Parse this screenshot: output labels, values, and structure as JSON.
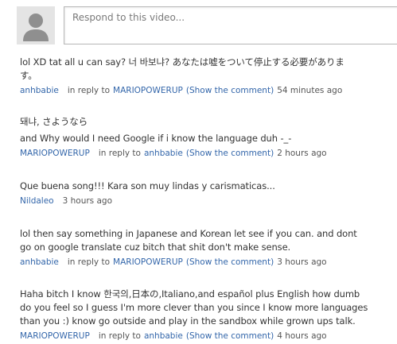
{
  "respond": {
    "placeholder": "Respond to this video..."
  },
  "comments": [
    {
      "lines": [
        "lol XD tat all u can say? 너 바보냐? あなたは嘘をついて停止する必要がありま",
        "す。"
      ],
      "author": "anhbabie",
      "in_reply_to": "in reply to",
      "reply_user": "MARIOPOWERUP",
      "show_comment": "(Show the comment)",
      "time": "54 minutes ago"
    },
    {
      "lines": [
        "돼냐, さようなら",
        "and Why would I need Google if i know the language duh -_-"
      ],
      "author": "MARIOPOWERUP",
      "in_reply_to": "in reply to",
      "reply_user": "anhbabie",
      "show_comment": "(Show the comment)",
      "time": "2 hours ago"
    },
    {
      "lines": [
        "Que buena song!!! Kara son muy lindas y carismaticas..."
      ],
      "author": "Nildaleo",
      "time": "3 hours ago"
    },
    {
      "lines": [
        "lol then say something in Japanese and Korean let see if you can. and dont",
        "go on google translate cuz bitch that shit don't make sense."
      ],
      "author": "anhbabie",
      "in_reply_to": "in reply to",
      "reply_user": "MARIOPOWERUP",
      "show_comment": "(Show the comment)",
      "time": "3 hours ago"
    },
    {
      "lines": [
        "Haha bitch I know 한국의,日本の,Italiano,and español plus English how dumb",
        "do you feel so I guess I'm more clever than you since I know more languages",
        "than you :) know go outside and play in the sandbox while grown ups talk."
      ],
      "author": "MARIOPOWERUP",
      "in_reply_to": "in reply to",
      "reply_user": "anhbabie",
      "show_comment": "(Show the comment)",
      "time": "4 hours ago"
    }
  ]
}
